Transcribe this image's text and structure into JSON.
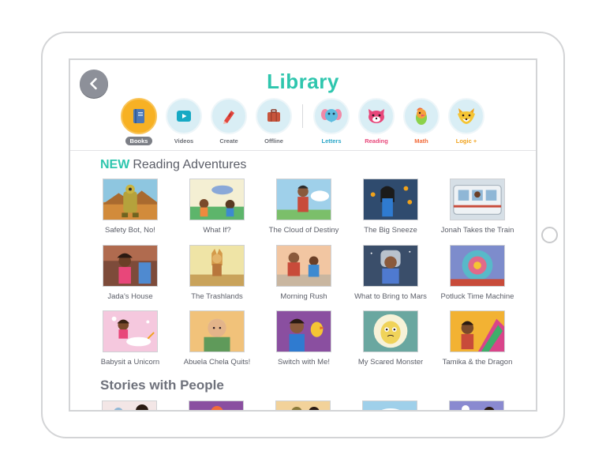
{
  "page": {
    "title": "Library"
  },
  "categories": [
    {
      "label": "Books",
      "icon": "book-icon",
      "active": true
    },
    {
      "label": "Videos",
      "icon": "play-icon",
      "active": false
    },
    {
      "label": "Create",
      "icon": "crayon-icon",
      "active": false
    },
    {
      "label": "Offline",
      "icon": "suitcase-icon",
      "active": false
    },
    {
      "label": "Letters",
      "icon": "elephant-icon",
      "color": "#2aa6c8"
    },
    {
      "label": "Reading",
      "icon": "redpanda-icon",
      "color": "#e8477a"
    },
    {
      "label": "Math",
      "icon": "bird-icon",
      "color": "#f26b3a"
    },
    {
      "label": "Logic +",
      "icon": "fox-icon",
      "color": "#f0a21c"
    }
  ],
  "sections": [
    {
      "new_tag": "NEW",
      "title": "Reading Adventures",
      "books": [
        [
          "Safety Bot, No!",
          "What If?",
          "The Cloud of Destiny",
          "The Big Sneeze",
          "Jonah Takes the Train"
        ],
        [
          "Jada's House",
          "The Trashlands",
          "Morning Rush",
          "What to Bring to Mars",
          "Potluck Time Machine"
        ],
        [
          "Babysit a Unicorn",
          "Abuela Chela Quits!",
          "Switch with Me!",
          "My Scared Monster",
          "Tamika & the Dragon"
        ]
      ]
    },
    {
      "title": "Stories with People"
    }
  ],
  "colors": {
    "accent": "#2fc6ae",
    "active_category": "#f7b124",
    "category_bg": "#d9eef5"
  }
}
